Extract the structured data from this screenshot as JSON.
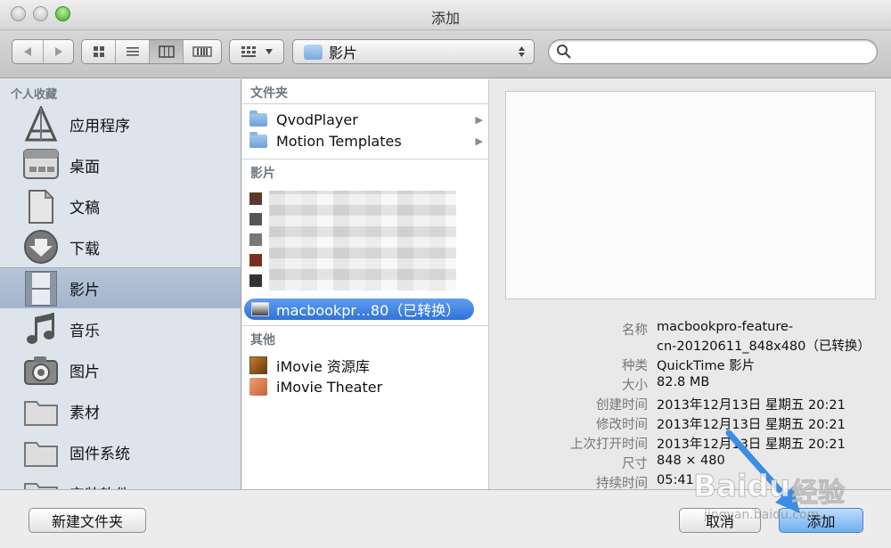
{
  "window": {
    "title": "添加"
  },
  "toolbar": {
    "location": "影片",
    "search_placeholder": ""
  },
  "sidebar": {
    "heading": "个人收藏",
    "items": [
      {
        "label": "应用程序",
        "icon": "applications-icon"
      },
      {
        "label": "桌面",
        "icon": "desktop-icon"
      },
      {
        "label": "文稿",
        "icon": "documents-icon"
      },
      {
        "label": "下载",
        "icon": "downloads-icon"
      },
      {
        "label": "影片",
        "icon": "movies-icon",
        "selected": true
      },
      {
        "label": "音乐",
        "icon": "music-icon"
      },
      {
        "label": "图片",
        "icon": "pictures-icon"
      },
      {
        "label": "素材",
        "icon": "folder-icon"
      },
      {
        "label": "固件系统",
        "icon": "folder-icon"
      },
      {
        "label": "安装软件",
        "icon": "folder-icon"
      }
    ]
  },
  "column": {
    "folders_heading": "文件夹",
    "folders": [
      "QvodPlayer",
      "Motion Templates"
    ],
    "movies_heading": "影片",
    "selected_movie": "macbookpr…80（已转换）",
    "other_heading": "其他",
    "other_items": [
      "iMovie 资源库",
      "iMovie Theater"
    ]
  },
  "preview": {
    "info": [
      {
        "key": "名称",
        "value": "macbookpro-feature-"
      },
      {
        "key": "",
        "value": "cn-20120611_848x480（已转换）"
      },
      {
        "key": "种类",
        "value": "QuickTime 影片"
      },
      {
        "key": "大小",
        "value": "82.8 MB"
      },
      {
        "key": "创建时间",
        "value": "2013年12月13日 星期五 20:21"
      },
      {
        "key": "修改时间",
        "value": "2013年12月13日 星期五 20:21"
      },
      {
        "key": "上次打开时间",
        "value": "2013年12月13日 星期五 20:21"
      },
      {
        "key": "尺寸",
        "value": "848 × 480"
      },
      {
        "key": "持续时间",
        "value": "05:41"
      }
    ]
  },
  "bottom": {
    "new_folder": "新建文件夹",
    "cancel": "取消",
    "add": "添加"
  },
  "watermark": {
    "text1": "Baidu",
    "text2": "经验",
    "text3": "jingyan.baidu.com"
  },
  "colors": {
    "sidebar_bg": "#dde4ec",
    "selection": "#2f73d8",
    "primary_button": "#6fb0f0"
  }
}
